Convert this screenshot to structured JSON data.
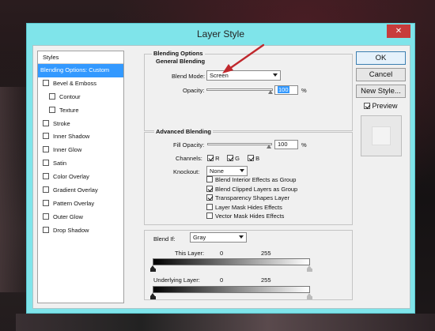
{
  "window": {
    "title": "Layer Style",
    "close_glyph": "✕"
  },
  "styles_panel": {
    "header": "Styles",
    "items": [
      {
        "label": "Blending Options: Custom",
        "active": true,
        "checkbox": false,
        "indent": 0
      },
      {
        "label": "Bevel & Emboss",
        "checkbox": true,
        "checked": false,
        "indent": 0
      },
      {
        "label": "Contour",
        "checkbox": true,
        "checked": false,
        "indent": 1
      },
      {
        "label": "Texture",
        "checkbox": true,
        "checked": false,
        "indent": 1
      },
      {
        "label": "Stroke",
        "checkbox": true,
        "checked": false,
        "indent": 0
      },
      {
        "label": "Inner Shadow",
        "checkbox": true,
        "checked": false,
        "indent": 0
      },
      {
        "label": "Inner Glow",
        "checkbox": true,
        "checked": false,
        "indent": 0
      },
      {
        "label": "Satin",
        "checkbox": true,
        "checked": false,
        "indent": 0
      },
      {
        "label": "Color Overlay",
        "checkbox": true,
        "checked": false,
        "indent": 0
      },
      {
        "label": "Gradient Overlay",
        "checkbox": true,
        "checked": false,
        "indent": 0
      },
      {
        "label": "Pattern Overlay",
        "checkbox": true,
        "checked": false,
        "indent": 0
      },
      {
        "label": "Outer Glow",
        "checkbox": true,
        "checked": false,
        "indent": 0
      },
      {
        "label": "Drop Shadow",
        "checkbox": true,
        "checked": false,
        "indent": 0
      }
    ]
  },
  "blending_options": {
    "group_title": "Blending Options",
    "general": {
      "title": "General Blending",
      "blend_mode_label": "Blend Mode:",
      "blend_mode_value": "Screen",
      "opacity_label": "Opacity:",
      "opacity_value": "100",
      "opacity_unit": "%"
    },
    "advanced": {
      "title": "Advanced Blending",
      "fill_opacity_label": "Fill Opacity:",
      "fill_opacity_value": "100",
      "fill_opacity_unit": "%",
      "channels_label": "Channels:",
      "channels": [
        {
          "label": "R",
          "checked": true
        },
        {
          "label": "G",
          "checked": true
        },
        {
          "label": "B",
          "checked": true
        }
      ],
      "knockout_label": "Knockout:",
      "knockout_value": "None",
      "options": [
        {
          "label": "Blend Interior Effects as Group",
          "checked": false
        },
        {
          "label": "Blend Clipped Layers as Group",
          "checked": true
        },
        {
          "label": "Transparency Shapes Layer",
          "checked": true
        },
        {
          "label": "Layer Mask Hides Effects",
          "checked": false
        },
        {
          "label": "Vector Mask Hides Effects",
          "checked": false
        }
      ]
    },
    "blend_if": {
      "label": "Blend If:",
      "value": "Gray",
      "this_layer_label": "This Layer:",
      "this_layer_min": "0",
      "this_layer_max": "255",
      "underlying_label": "Underlying Layer:",
      "underlying_min": "0",
      "underlying_max": "255"
    }
  },
  "buttons": {
    "ok": "OK",
    "cancel": "Cancel",
    "new_style": "New Style...",
    "preview_label": "Preview",
    "preview_checked": true
  },
  "colors": {
    "title_bar": "#7fe4ea",
    "close": "#c73b3b",
    "selection": "#3399ff",
    "annotation_arrow": "#c0282d"
  }
}
